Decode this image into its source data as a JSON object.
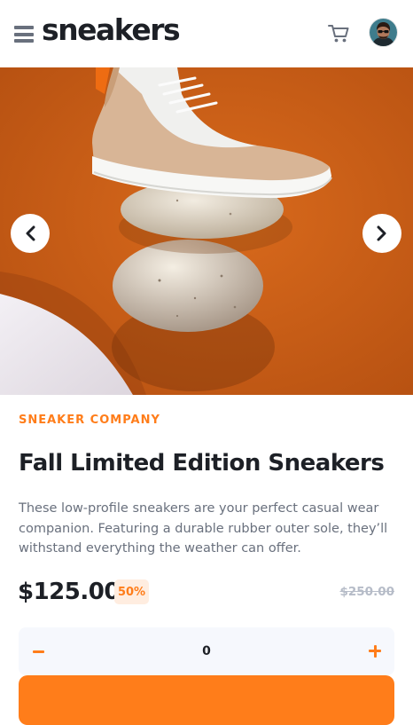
{
  "header": {
    "logo": "sneakers",
    "menu_icon": "hamburger-menu-icon",
    "cart_icon": "cart-icon",
    "avatar_icon": "user-avatar"
  },
  "gallery": {
    "image_description_icon": "product-image",
    "prev_icon": "chevron-left-icon",
    "next_icon": "chevron-right-icon"
  },
  "product": {
    "company": "SNEAKER COMPANY",
    "title": "Fall Limited Edition Sneakers",
    "description": "These low-profile sneakers are your perfect casual wear companion. Featuring a durable rubber outer sole, they’ll withstand everything the weather can offer.",
    "price": "$125.00",
    "discount": "50%",
    "original_price": "$250.00"
  },
  "quantity": {
    "value": "0",
    "minus_icon": "minus-icon",
    "plus_icon": "plus-icon"
  },
  "colors": {
    "accent": "#ff7d1a",
    "accent_pale": "#ffede0",
    "dark": "#1d2026",
    "grey": "#69707d",
    "light_grey": "#b6bcc8",
    "qty_bg": "#f6f8fd"
  }
}
